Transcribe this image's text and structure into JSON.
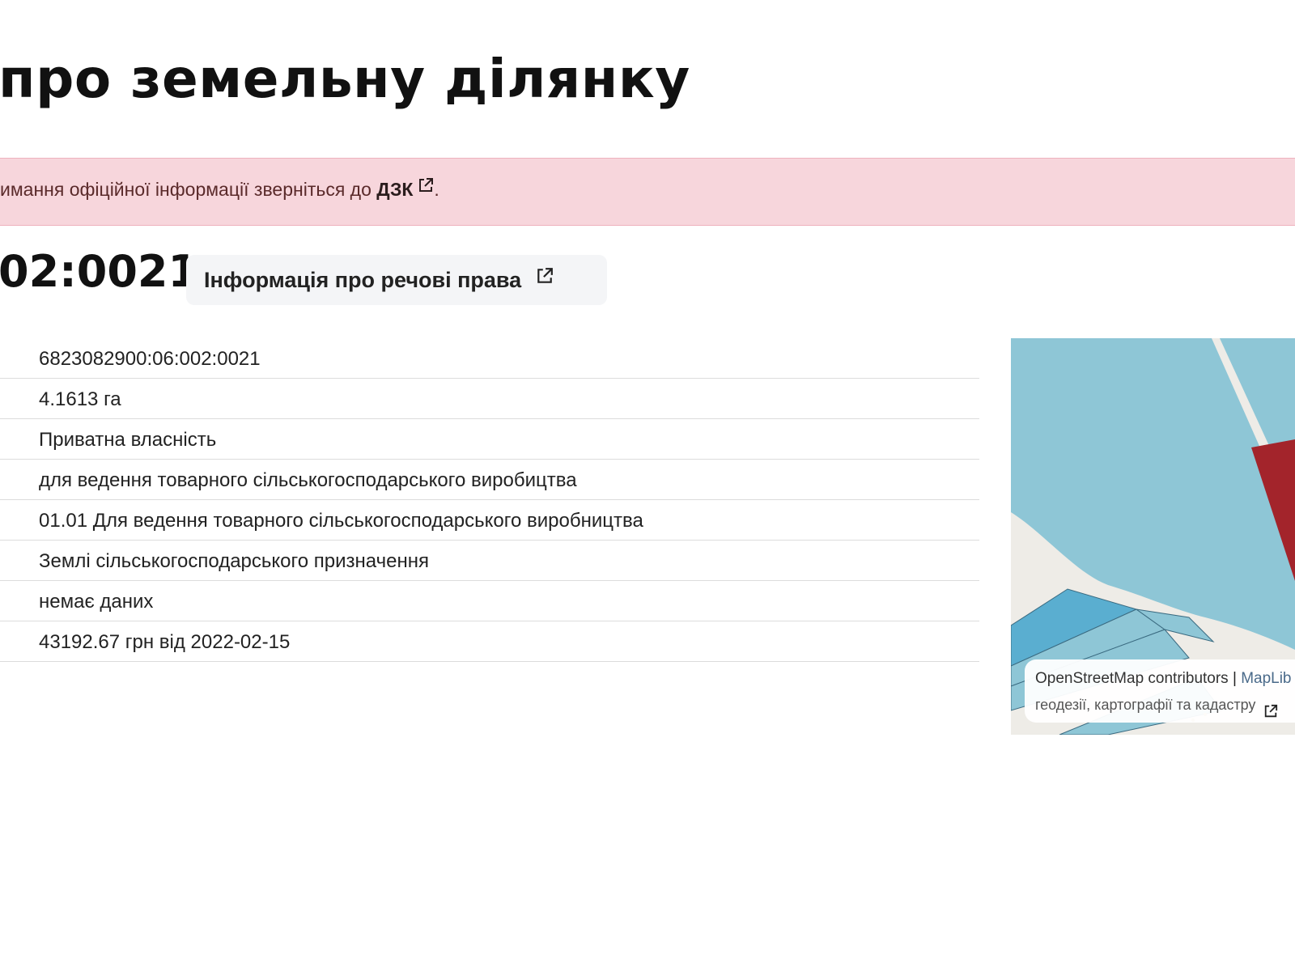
{
  "header": {
    "title": "про земельну ділянку"
  },
  "alert": {
    "text": "имання офіційної інформації зверніться до ",
    "link_label": "ДЗК",
    "suffix": ".",
    "background": "#f7d6dc"
  },
  "parcel": {
    "cadnum_partial": "02:0021",
    "rights_button_label": "Інформація про речові права"
  },
  "details": {
    "rows": [
      {
        "value": "6823082900:06:002:0021"
      },
      {
        "value": "4.1613 га"
      },
      {
        "value": "Приватна власність"
      },
      {
        "value": "для ведення товарного сільськогосподарського виробицтва"
      },
      {
        "value": "01.01 Для ведення товарного сільськогосподарського виробництва"
      },
      {
        "value": "Землі сільськогосподарського призначення"
      },
      {
        "value": "немає даних"
      },
      {
        "value": "43192.67 грн від 2022-02-15"
      }
    ]
  },
  "map": {
    "attribution_osm": "OpenStreetMap contributors",
    "attribution_separator": " | ",
    "attribution_maplibre": "MapLib",
    "attribution_line2": "геодезії, картографії та кадастру",
    "colors": {
      "water_blue": "#8ec6d6",
      "dark_blue": "#5aaed0",
      "parcel_red": "#a3242b",
      "land_gray": "#eeece7"
    }
  }
}
